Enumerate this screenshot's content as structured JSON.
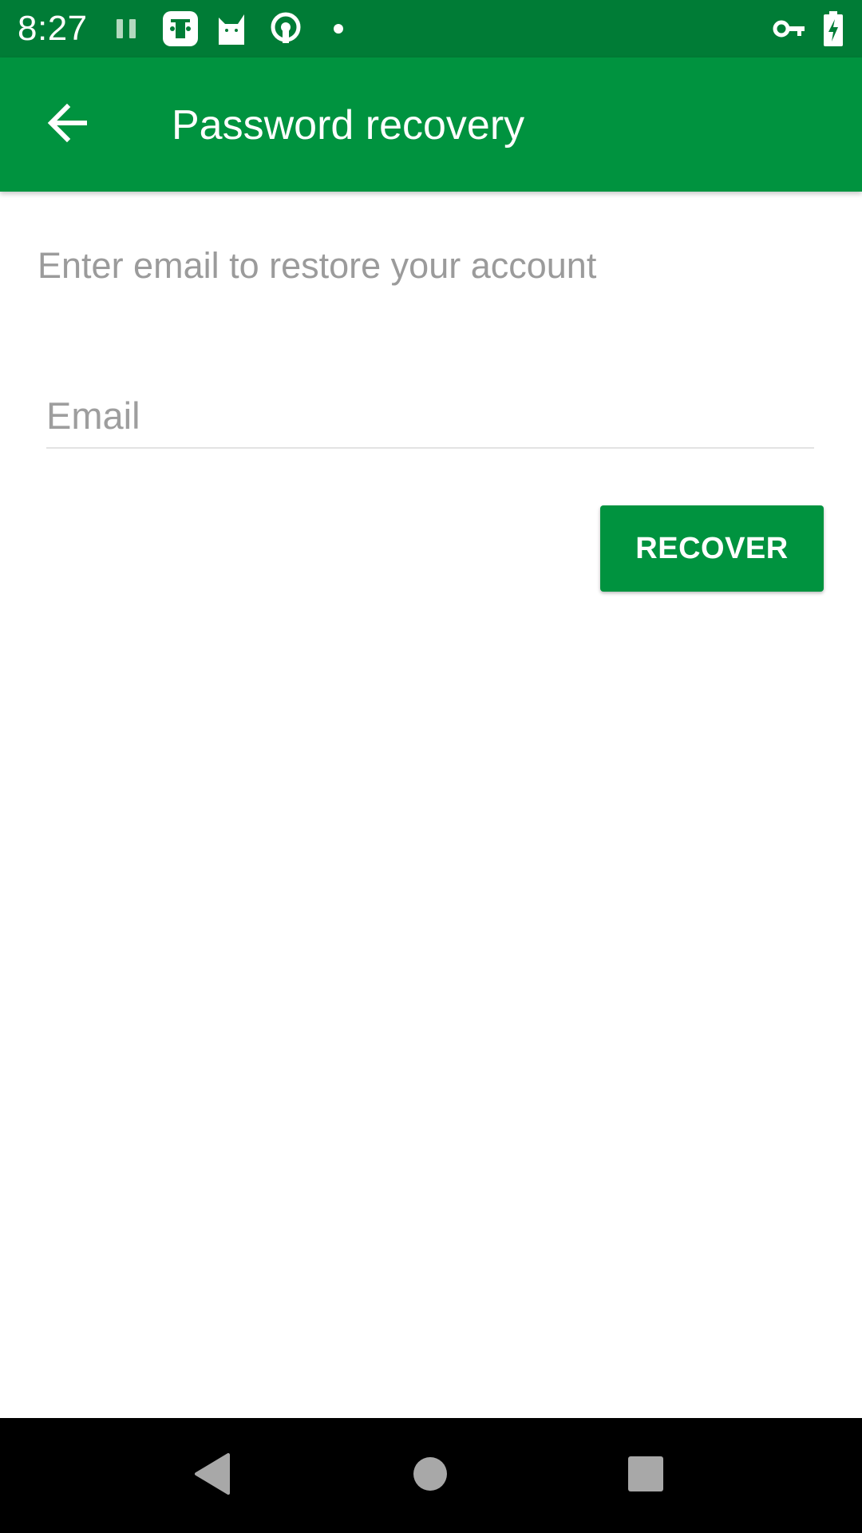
{
  "status_bar": {
    "time": "8:27",
    "icons": [
      "pause-icon",
      "app-notification-icon",
      "cat-app-icon",
      "podcast-icon",
      "dot-icon",
      "vpn-key-icon",
      "battery-charging-icon"
    ]
  },
  "app_bar": {
    "title": "Password recovery",
    "back_icon": "arrow-back-icon"
  },
  "form": {
    "instructions": "Enter email to restore your account",
    "email_placeholder": "Email",
    "email_value": "",
    "recover_label": "RECOVER"
  },
  "nav_bar": {
    "icons": [
      "back-triangle-icon",
      "home-circle-icon",
      "recents-square-icon"
    ]
  },
  "colors": {
    "status_bar": "#007c36",
    "app_bar": "#00933f",
    "accent": "#00933f",
    "hint_text": "#9b9b9b",
    "nav_bar": "#000000"
  }
}
